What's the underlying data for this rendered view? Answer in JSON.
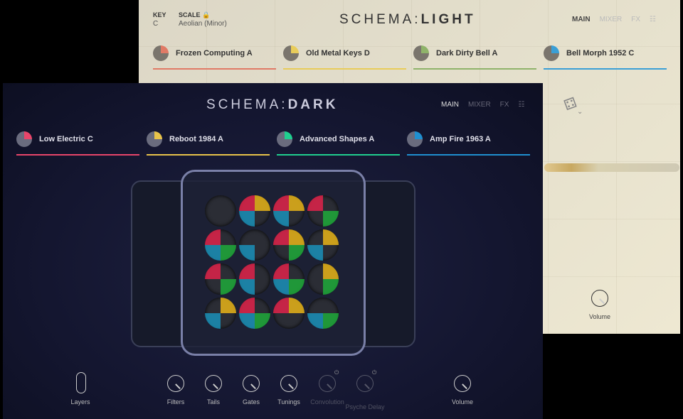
{
  "light": {
    "key_label": "KEY",
    "key_value": "C",
    "scale_label": "SCALE",
    "scale_value": "Aeolian (Minor)",
    "logo_left": "SCHEMA",
    "logo_sep": ":",
    "logo_right": "LIGHT",
    "nav": [
      "MAIN",
      "MIXER",
      "FX"
    ],
    "slots": [
      {
        "name": "Frozen Computing A",
        "color": "#e07a66"
      },
      {
        "name": "Old Metal Keys D",
        "color": "#e8cc5a"
      },
      {
        "name": "Dark Dirty Bell A",
        "color": "#8fb36a"
      },
      {
        "name": "Bell Morph 1952 C",
        "color": "#3a9fd6"
      }
    ],
    "volume_label": "Volume"
  },
  "dark": {
    "logo_left": "SCHEMA",
    "logo_sep": ":",
    "logo_right": "DARK",
    "nav": [
      "MAIN",
      "MIXER",
      "FX"
    ],
    "slots": [
      {
        "name": "Low Electric C",
        "color": "#e8456a"
      },
      {
        "name": "Reboot 1984 A",
        "color": "#e8c34a"
      },
      {
        "name": "Advanced Shapes A",
        "color": "#1fcf8f"
      },
      {
        "name": "Amp Fire 1963 A",
        "color": "#1f8fd0"
      }
    ],
    "controls": [
      {
        "label": "Layers",
        "enabled": true
      },
      {
        "label": "Filters",
        "enabled": true
      },
      {
        "label": "Tails",
        "enabled": true
      },
      {
        "label": "Gates",
        "enabled": true
      },
      {
        "label": "Tunings",
        "enabled": true
      },
      {
        "label": "Convolution",
        "enabled": false
      },
      {
        "label": "Psyche Delay",
        "enabled": false
      },
      {
        "label": "Volume",
        "enabled": true
      }
    ],
    "sequencer_grid": [
      [
        "",
        "RYB",
        "RYB",
        "RG"
      ],
      [
        "RBG",
        "B",
        "RYG",
        "YB"
      ],
      [
        "RG",
        "RB",
        "RBG",
        "YG"
      ],
      [
        "YB",
        "RBG",
        "RY",
        "BG"
      ]
    ]
  }
}
